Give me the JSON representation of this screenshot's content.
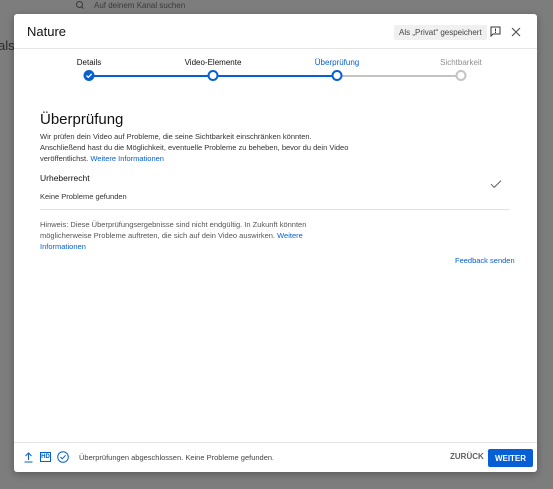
{
  "background": {
    "search_placeholder": "Auf deinem Kanal suchen",
    "side_text": "als"
  },
  "dialog": {
    "title": "Nature",
    "saved_badge": "Als „Privat“ gespeichert",
    "icons": {
      "feedback": "feedback-icon",
      "close": "close-icon"
    }
  },
  "stepper": {
    "steps": [
      {
        "label": "Details",
        "state": "done"
      },
      {
        "label": "Video-Elemente",
        "state": "done"
      },
      {
        "label": "Überprüfung",
        "state": "current"
      },
      {
        "label": "Sichtbarkeit",
        "state": "upcoming"
      }
    ],
    "colors": {
      "active": "#065fd4",
      "inactive": "#c4c4c4"
    }
  },
  "content": {
    "title": "Überprüfung",
    "intro_text": "Wir prüfen dein Video auf Probleme, die seine Sichtbarkeit einschränken könnten. Anschließend hast du die Möglichkeit, eventuelle Probleme zu beheben, bevor du dein Video veröffentlichst.",
    "intro_link": "Weitere Informationen",
    "copyright": {
      "label": "Urheberrecht",
      "status": "Keine Probleme gefunden"
    },
    "hint_text": "Hinweis: Diese Überprüfungsergebnisse sind nicht endgültig. In Zukunft könnten möglicherweise Probleme auftreten, die sich auf dein Video auswirken.",
    "hint_link": "Weitere Informationen",
    "feedback_link": "Feedback senden"
  },
  "footer": {
    "hd_label": "HD",
    "status": "Überprüfungen abgeschlossen. Keine Probleme gefunden.",
    "back_label": "ZURÜCK",
    "next_label": "WEITER"
  },
  "colors": {
    "accent": "#065fd4"
  }
}
